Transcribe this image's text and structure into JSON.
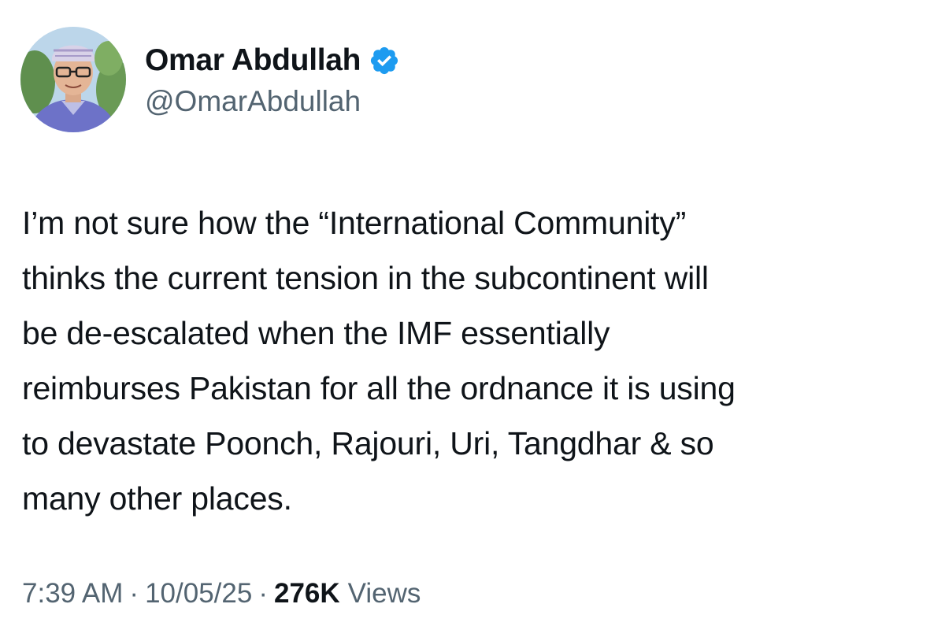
{
  "author": {
    "display_name": "Omar Abdullah",
    "handle": "@OmarAbdullah",
    "verified": true,
    "verified_color": "#1d9bf0",
    "avatar_icon": "profile-photo"
  },
  "tweet": {
    "lines": [
      "I’m not sure how the “International Community”",
      "thinks the current tension in the subcontinent will",
      "be de-escalated when the IMF essentially",
      "reimburses Pakistan for all the ordnance it is using",
      "to devastate Poonch, Rajouri, Uri, Tangdhar & so",
      "many other places."
    ]
  },
  "meta": {
    "time": "7:39 AM",
    "separator": "·",
    "date": "10/05/25",
    "views_count": "276K",
    "views_label": "Views"
  },
  "colors": {
    "text_primary": "#0f1419",
    "text_secondary": "#536471",
    "background": "#ffffff"
  }
}
